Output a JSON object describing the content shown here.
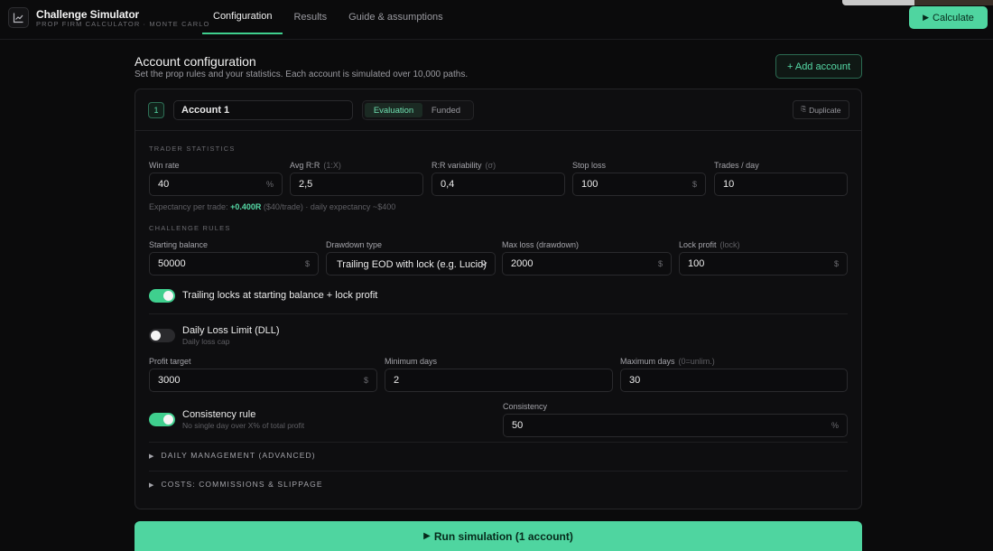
{
  "app": {
    "title": "Challenge Simulator",
    "subtitle": "PROP FIRM CALCULATOR · MONTE CARLO"
  },
  "nav": {
    "tabs": [
      {
        "label": "Configuration",
        "active": true
      },
      {
        "label": "Results",
        "active": false
      },
      {
        "label": "Guide & assumptions",
        "active": false
      }
    ],
    "calculate_label": "Calculate"
  },
  "header": {
    "title": "Account configuration",
    "description": "Set the prop rules and your statistics. Each account is simulated over 10,000 paths.",
    "add_account_label": "+ Add account"
  },
  "account": {
    "number": "1",
    "name": "Account 1",
    "mode_options": [
      "Evaluation",
      "Funded"
    ],
    "mode_selected": "Evaluation",
    "duplicate_label": "Duplicate"
  },
  "trader_stats": {
    "section_label": "TRADER STATISTICS",
    "win_rate": {
      "label": "Win rate",
      "value": "40",
      "unit": "%"
    },
    "avg_rr": {
      "label": "Avg R:R",
      "hint": "(1:X)",
      "value": "2,5"
    },
    "rr_variability": {
      "label": "R:R variability",
      "hint": "(σ)",
      "value": "0,4"
    },
    "stop_loss": {
      "label": "Stop loss",
      "value": "100",
      "unit": "$"
    },
    "trades_per_day": {
      "label": "Trades / day",
      "value": "10"
    },
    "expectancy": {
      "prefix": "Expectancy per trade:",
      "value": "+0.400R",
      "suffix": "($40/trade) · daily expectancy ~$400"
    }
  },
  "challenge_rules": {
    "section_label": "CHALLENGE RULES",
    "starting_balance": {
      "label": "Starting balance",
      "value": "50000",
      "unit": "$"
    },
    "drawdown_type": {
      "label": "Drawdown type",
      "value": "Trailing EOD with lock (e.g. Lucid)"
    },
    "max_loss": {
      "label": "Max loss (drawdown)",
      "value": "2000",
      "unit": "$"
    },
    "lock_profit": {
      "label": "Lock profit",
      "hint": "(lock)",
      "value": "100",
      "unit": "$"
    },
    "trailing_lock": {
      "label": "Trailing locks at starting balance + lock profit",
      "on": true
    },
    "dll": {
      "label": "Daily Loss Limit (DLL)",
      "sub": "Daily loss cap",
      "on": false
    },
    "profit_target": {
      "label": "Profit target",
      "value": "3000",
      "unit": "$"
    },
    "min_days": {
      "label": "Minimum days",
      "value": "2"
    },
    "max_days": {
      "label": "Maximum days",
      "hint": "(0=unlim.)",
      "value": "30"
    },
    "consistency_rule": {
      "label": "Consistency rule",
      "sub": "No single day over X% of total profit",
      "on": true
    },
    "consistency": {
      "label": "Consistency",
      "value": "50",
      "unit": "%"
    }
  },
  "sections": {
    "daily_management": "DAILY MANAGEMENT (ADVANCED)",
    "costs": "COSTS: COMMISSIONS & SLIPPAGE"
  },
  "run_label": "Run simulation (1 account)",
  "colors": {
    "accent": "#4fd5a0",
    "background": "#0b0b0c"
  }
}
